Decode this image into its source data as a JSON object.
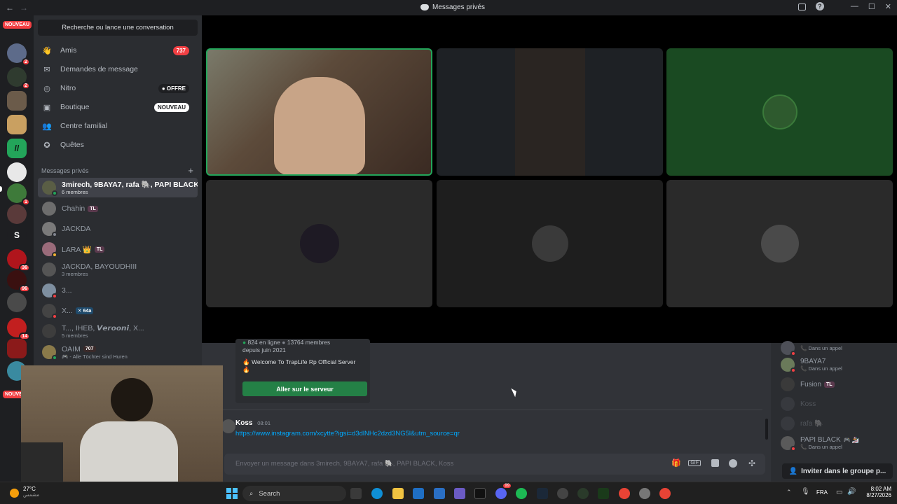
{
  "titlebar": {
    "title": "Messages privés",
    "back": "←",
    "forward": "→",
    "inbox_icon": "inbox-icon",
    "help": "?",
    "minimize": "—",
    "maximize": "☐",
    "close": "✕"
  },
  "servers": {
    "nouveau_top": "NOUVEAU",
    "nouveau_bottom": "NOUVE",
    "badges": [
      "2",
      "2",
      "1",
      "36",
      "96",
      "14"
    ],
    "letter_server": "S"
  },
  "dm_sidebar": {
    "search_label": "Recherche ou lance une conversation",
    "nav": [
      {
        "label": "Amis",
        "badge": "737"
      },
      {
        "label": "Demandes de message",
        "badge": ""
      },
      {
        "label": "Nitro",
        "badge": "OFFRE"
      },
      {
        "label": "Boutique",
        "badge": "NOUVEAU"
      },
      {
        "label": "Centre familial",
        "badge": ""
      },
      {
        "label": "Quêtes",
        "badge": ""
      }
    ],
    "header": "Messages privés",
    "add": "+",
    "dms": [
      {
        "name": "3mirech, 9BAYA7, rafa 🐘, PAPI BLACK,...",
        "sub": "6 membres",
        "tag": ""
      },
      {
        "name": "Chahin",
        "sub": "",
        "tag": "TL"
      },
      {
        "name": "JACKDA",
        "sub": "",
        "tag": ""
      },
      {
        "name": "LARA 👑",
        "sub": "",
        "tag": "TL"
      },
      {
        "name": "JACKDA, BAYOUDHIII",
        "sub": "3 membres",
        "tag": ""
      },
      {
        "name": "3...",
        "sub": "",
        "tag": ""
      },
      {
        "name": "X...",
        "sub": "",
        "tag": "64a"
      },
      {
        "name": "T..., IHEB, 𝙑𝙚𝙧𝙤𝙤𝙣𝙞, X...",
        "sub": "5 membres",
        "tag": ""
      },
      {
        "name": "OAIM",
        "sub": "🎮 - Alle Töchter sind Huren",
        "tag": "707"
      }
    ]
  },
  "chat": {
    "invite": {
      "online": "824 en ligne",
      "members": "13764 membres",
      "since": "depuis juin 2021",
      "welcome": "Welcome To TrapLife Rp Official Server",
      "button": "Aller sur le serveur"
    },
    "message": {
      "author": "Koss",
      "time": "08:01",
      "link": "https://www.instagram.com/xcytte?igsi=d3dlNHc2dzd3NG5l&utm_source=qr"
    },
    "composer_placeholder": "Envoyer un message dans 3mirech, 9BAYA7, rafa 🐘, PAPI BLACK, Koss"
  },
  "members": [
    {
      "name": "",
      "status": "Dans un appel",
      "tag": ""
    },
    {
      "name": "9BAYA7",
      "status": "Dans un appel",
      "tag": ""
    },
    {
      "name": "Fusion",
      "status": "",
      "tag": "TL"
    },
    {
      "name": "Koss",
      "status": "",
      "tag": ""
    },
    {
      "name": "rafa 🐘",
      "status": "",
      "tag": ""
    },
    {
      "name": "PAPI BLACK",
      "status": "Dans un appel",
      "tag": "🎮 🏂"
    }
  ],
  "invite_group_button": "Inviter dans le groupe p...",
  "taskbar": {
    "weather_temp": "27°C",
    "weather_sub": "مشمس",
    "search": "Search",
    "lang": "FRA",
    "time": "8:02 AM",
    "date": "8/27/2026",
    "discord_badge": "99"
  },
  "colors": {
    "accent_green": "#248046",
    "red": "#f23f43",
    "blurple": "#5865f2"
  }
}
